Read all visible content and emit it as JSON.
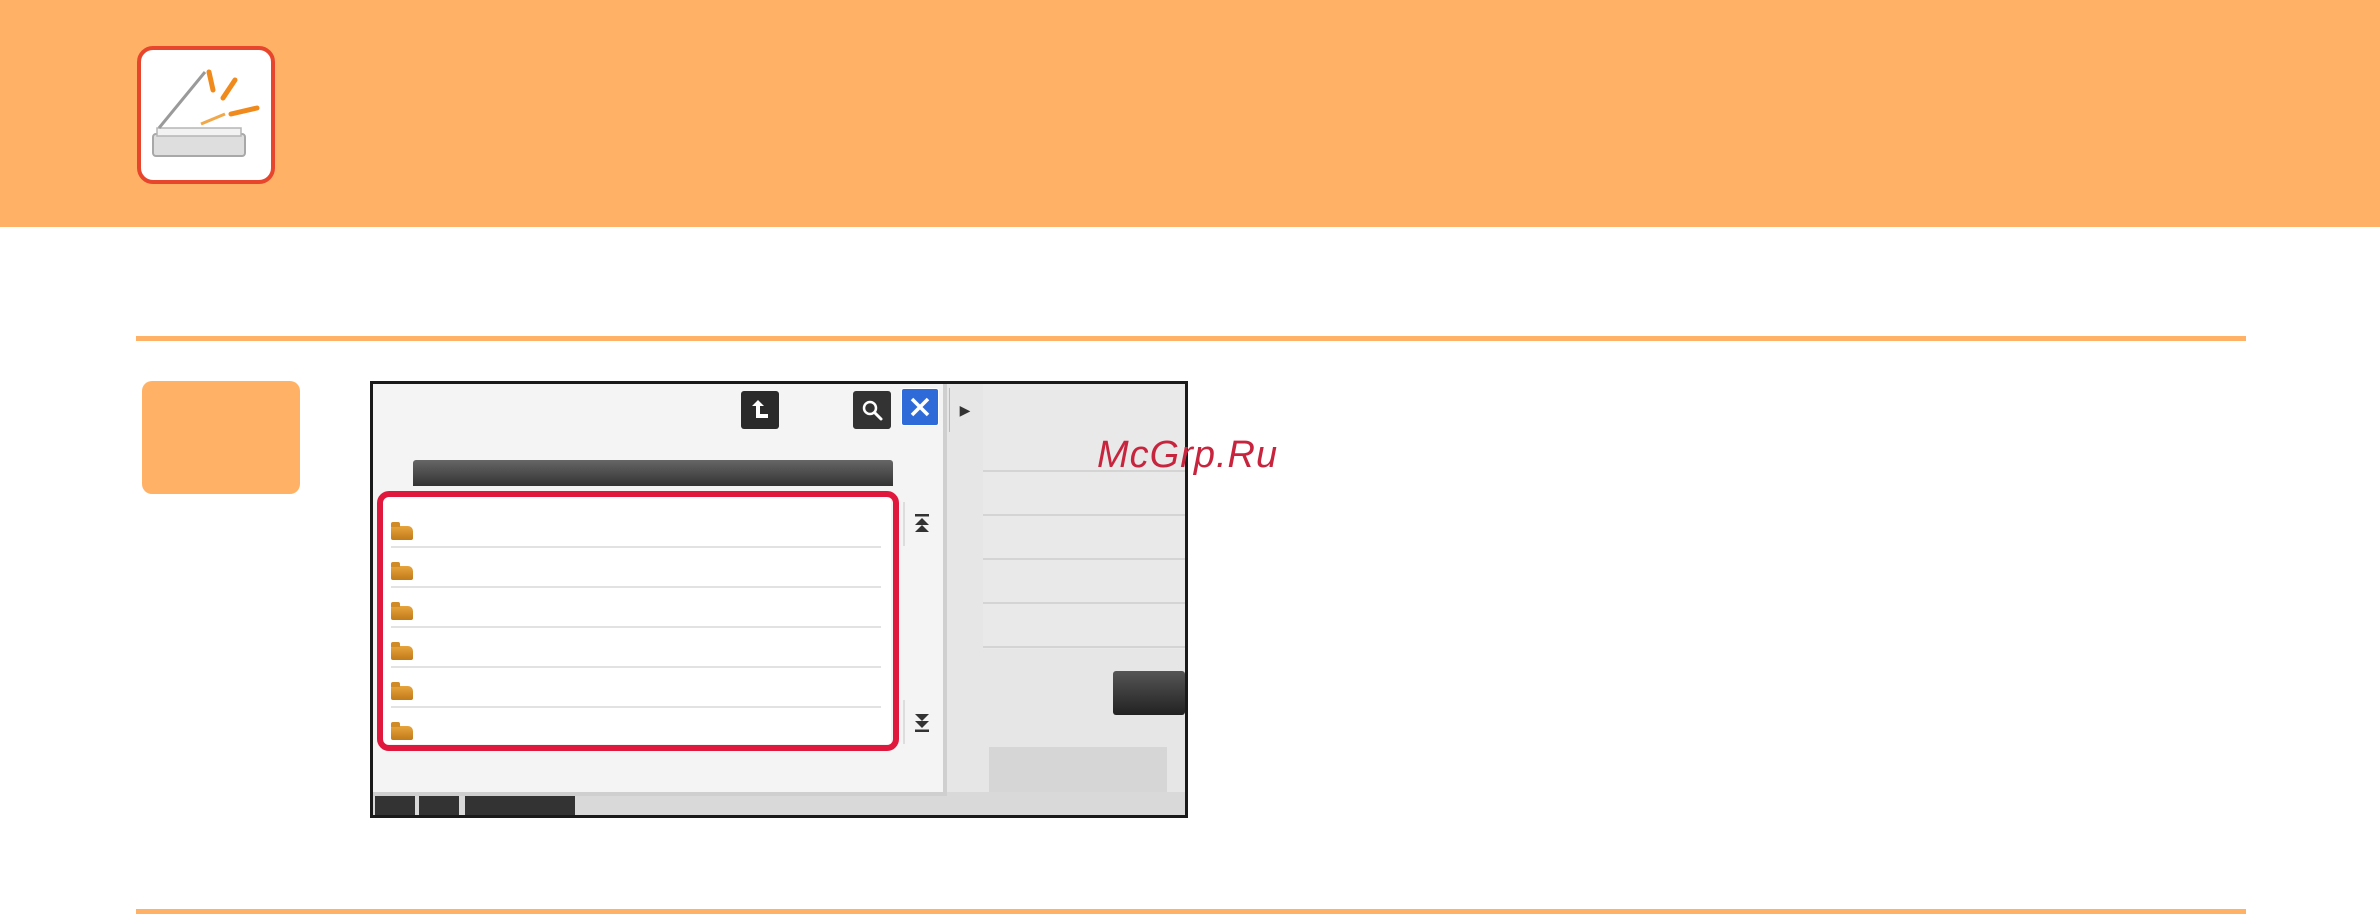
{
  "header": {
    "icon": "scanner-icon",
    "accent_color": "#ffb266",
    "icon_border_color": "#e8452d"
  },
  "screenshot": {
    "dialog": {
      "buttons": {
        "up_icon": "up-folder-icon",
        "search_icon": "search-icon",
        "close_icon": "close-icon"
      },
      "folders": [
        {
          "icon": "folder-icon"
        },
        {
          "icon": "folder-icon"
        },
        {
          "icon": "folder-icon"
        },
        {
          "icon": "folder-icon"
        },
        {
          "icon": "folder-icon"
        },
        {
          "icon": "folder-icon"
        }
      ],
      "scroll": {
        "up_icon": "scroll-top-icon",
        "down_icon": "scroll-bottom-icon"
      },
      "highlight_color": "#e0183e"
    }
  },
  "watermark": {
    "text": "McGrp.Ru"
  }
}
